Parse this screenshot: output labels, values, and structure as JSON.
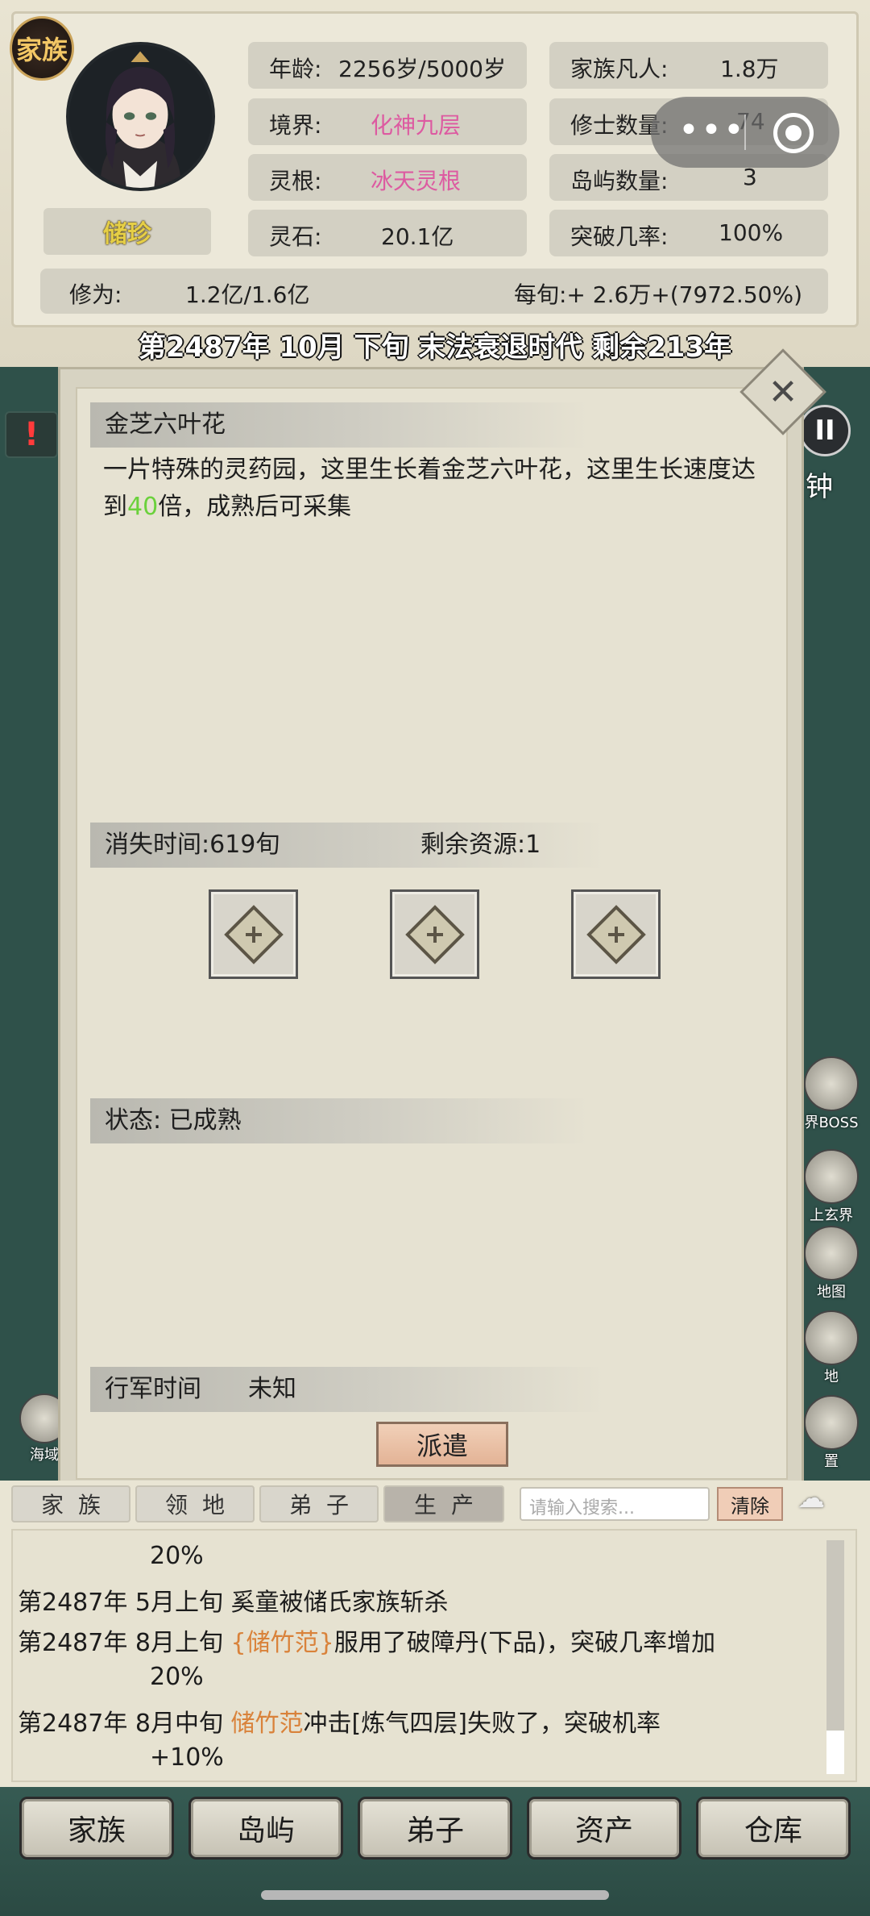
{
  "header": {
    "clan_badge": "家族",
    "character_name": "储珍",
    "stats_left": [
      {
        "label": "年龄:",
        "value": "2256岁/5000岁"
      },
      {
        "label": "境界:",
        "value": "化神九层"
      },
      {
        "label": "灵根:",
        "value": "冰天灵根"
      },
      {
        "label": "灵石:",
        "value": "20.1亿"
      }
    ],
    "stats_right": [
      {
        "label": "家族凡人:",
        "value": "1.8万"
      },
      {
        "label": "修士数量:",
        "value": "74"
      },
      {
        "label": "岛屿数量:",
        "value": "3"
      },
      {
        "label": "突破几率:",
        "value": "100%"
      }
    ],
    "cultivation_label": "修为:",
    "cultivation_value": "1.2亿/1.6亿",
    "per_period": "每旬:+ 2.6万+(7972.50%)",
    "year_banner": "第2487年 10月 下旬  末法衰退时代 剩余213年"
  },
  "mini_program": {
    "more_icon": "more-dots-icon",
    "close_icon": "target-icon"
  },
  "map_side": {
    "pause_label": "II",
    "clock_label": "钟",
    "right_icons": [
      {
        "icon": "boss-icon",
        "label": "界BOSS"
      },
      {
        "icon": "mountain-icon",
        "label": "上玄界"
      },
      {
        "icon": "map-pin-icon",
        "label": "地图"
      },
      {
        "icon": "land-icon",
        "label": "地"
      },
      {
        "icon": "gear-icon",
        "label": "置"
      }
    ],
    "sea_label": "海域"
  },
  "dialog": {
    "title": "金芝六叶花",
    "desc_part1": "一片特殊的灵药园，这里生长着金芝六叶花，这里生长速度达到",
    "desc_highlight": "40",
    "desc_part2": "倍，成熟后可采集",
    "disappear_time": "消失时间:619旬",
    "remaining_resources": "剩余资源:1",
    "status": "状态:  已成熟",
    "march_time_label": "行军时间",
    "march_time_value": "未知",
    "dispatch_button": "派遣",
    "accent_green": "#6bd13c"
  },
  "log_tabs": [
    "家族",
    "领地",
    "弟子",
    "生产"
  ],
  "active_tab": "生产",
  "search": {
    "placeholder": "请输入搜索...",
    "clear_label": "清除"
  },
  "log_entries": [
    {
      "date": "",
      "pre": "20%",
      "name": "",
      "post": ""
    },
    {
      "date": "第2487年",
      "pre": "5月上旬 奚童被储氏家族斩杀",
      "name": "",
      "post": ""
    },
    {
      "date": "第2487年",
      "pre": "8月上旬 ",
      "name": "{储竹范}",
      "post": "服用了破障丹(下品)，突破几率增加"
    },
    {
      "date": "",
      "pre": "20%",
      "name": "",
      "post": ""
    },
    {
      "date": "第2487年",
      "pre": "8月中旬 ",
      "name": "储竹范",
      "post": "冲击[炼气四层]失败了，突破机率"
    },
    {
      "date": "",
      "pre": "+10%",
      "name": "",
      "post": ""
    }
  ],
  "bottom_nav": [
    "家族",
    "岛屿",
    "弟子",
    "资产",
    "仓库"
  ]
}
